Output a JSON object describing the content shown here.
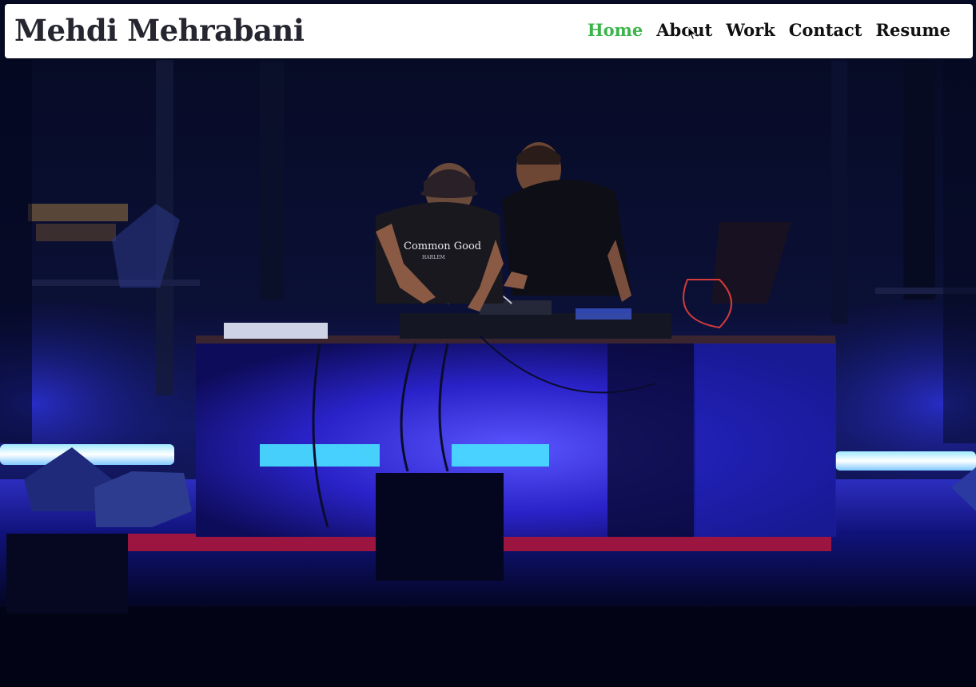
{
  "site": {
    "brand": "Mehdi Mehrabani"
  },
  "nav": {
    "items": [
      {
        "label": "Home",
        "active": true
      },
      {
        "label": "About",
        "active": false
      },
      {
        "label": "Work",
        "active": false
      },
      {
        "label": "Contact",
        "active": false
      },
      {
        "label": "Resume",
        "active": false
      }
    ]
  },
  "hero": {
    "shirt_text": "Common Good",
    "shirt_subtext": "HARLEM"
  },
  "colors": {
    "accent": "#3bb54a",
    "nav_text": "#111111",
    "brand_text": "#262630",
    "navbar_bg": "#ffffff",
    "stage_light": "#2b2cff",
    "led_cyan": "#3fe6ff"
  },
  "icons": {
    "cursor": "arrow-pointer-icon"
  }
}
